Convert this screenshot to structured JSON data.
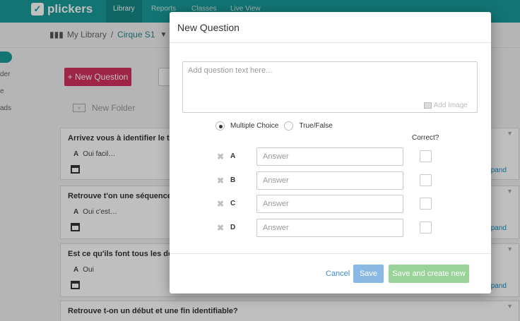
{
  "app": {
    "logo_text": "plickers",
    "logo_glyph": "✓"
  },
  "nav": {
    "tabs": [
      "Library",
      "Reports",
      "Classes",
      "Live View"
    ]
  },
  "breadcrumb": {
    "root": "My Library",
    "separator": "/",
    "current": "Cirque S1"
  },
  "sidebar": {
    "items": [
      "der",
      "e",
      "ads"
    ]
  },
  "main": {
    "new_question_label": "+ New Question",
    "new_folder_label": "New Folder",
    "cards": [
      {
        "title": "Arrivez vous à identifier le thè",
        "answer_letter": "A",
        "answer": "Oui facil…",
        "expand": "xpand"
      },
      {
        "title": "Retrouve t'on une séquence av",
        "answer_letter": "A",
        "answer": "Oui c'est…",
        "expand": "xpand"
      },
      {
        "title": "Est ce qu'ils font tous les deux",
        "answer_letter": "A",
        "answer": "Oui",
        "expand": "xpand"
      },
      {
        "title": "Retrouve t-on un début et une fin identifiable?",
        "answer_letter": "",
        "answer": "",
        "expand": ""
      }
    ]
  },
  "modal": {
    "title": "New Question",
    "question_placeholder": "Add question text here...",
    "add_image_label": "Add Image",
    "type_options": [
      {
        "label": "Multiple Choice",
        "selected": true
      },
      {
        "label": "True/False",
        "selected": false
      }
    ],
    "correct_header": "Correct?",
    "answers": [
      {
        "letter": "A",
        "placeholder": "Answer",
        "value": ""
      },
      {
        "letter": "B",
        "placeholder": "Answer",
        "value": ""
      },
      {
        "letter": "C",
        "placeholder": "Answer",
        "value": ""
      },
      {
        "letter": "D",
        "placeholder": "Answer",
        "value": ""
      }
    ],
    "cancel_label": "Cancel",
    "save_label": "Save",
    "save_new_label": "Save and create new"
  },
  "colors": {
    "teal": "#1a9b9b",
    "pink": "#d6305f",
    "save_blue": "#8ab9e4",
    "save_green": "#9ad39a"
  }
}
